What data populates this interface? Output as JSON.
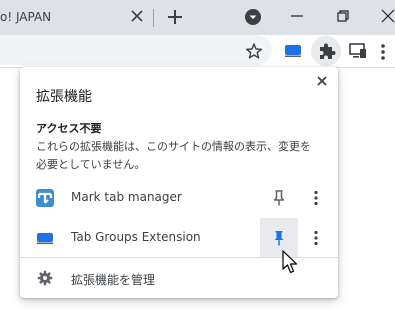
{
  "tab": {
    "title": "o! JAPAN"
  },
  "extensions_popup": {
    "title": "拡張機能",
    "section_title": "アクセス不要",
    "section_desc": "これらの拡張機能は、このサイトの情報の表示、変更を必要としていません。",
    "extensions": [
      {
        "name": "Mark tab manager",
        "pinned": false,
        "icon": "mark-tab-manager-icon"
      },
      {
        "name": "Tab Groups Extension",
        "pinned": true,
        "icon": "tab-groups-extension-icon"
      }
    ],
    "manage_label": "拡張機能を管理"
  },
  "colors": {
    "accent": "#1a73e8",
    "pin_active_bg": "#e8eaed",
    "tabstrip_bg": "#dee1e6"
  }
}
